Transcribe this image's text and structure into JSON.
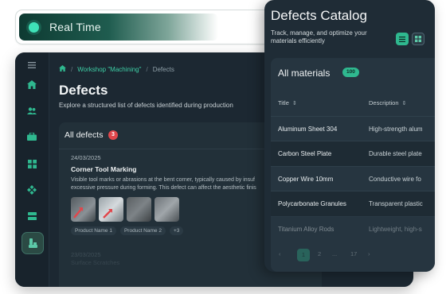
{
  "realtime": {
    "label": "Real Time"
  },
  "breadcrumb": {
    "link": "Workshop \"Machining\"",
    "current": "Defects"
  },
  "page": {
    "title": "Defects",
    "subtitle": "Explore a structured list of defects identified during production"
  },
  "defects": {
    "heading": "All defects",
    "count": "3",
    "items": [
      {
        "date": "24/03/2025",
        "title": "Corner Tool Marking",
        "desc_line1": "Visible tool marks or abrasions at the bent corner, typically caused by insuf",
        "desc_line2": "excessive pressure during forming. This defect can affect the aesthetic finis",
        "tags": [
          "Product Name 1",
          "Product Name 2",
          "+3"
        ]
      }
    ],
    "faded": [
      "23/03/2025",
      "Surface Scratches"
    ]
  },
  "catalog": {
    "title": "Defects Catalog",
    "subtitle": "Track, manage, and optimize your materials efficiently",
    "all_label": "All materials",
    "total": "100",
    "columns": [
      "Title",
      "Description"
    ],
    "rows": [
      {
        "title": "Aluminum Sheet 304",
        "desc": "High-strength alum"
      },
      {
        "title": "Carbon Steel Plate",
        "desc": "Durable steel plate"
      },
      {
        "title": "Copper Wire 10mm",
        "desc": "Conductive wire fo"
      },
      {
        "title": "Polycarbonate Granules",
        "desc": "Transparent plastic"
      },
      {
        "title": "Titanium Alloy Rods",
        "desc": "Lightweight, high-s"
      }
    ],
    "pager": {
      "prev": "‹",
      "current": "1",
      "next_page": "2",
      "ellipsis": "...",
      "last": "17",
      "next": "›"
    }
  },
  "colors": {
    "accent": "#2fb88f",
    "badge_red": "#e0474c",
    "bg": "#1c2832"
  }
}
